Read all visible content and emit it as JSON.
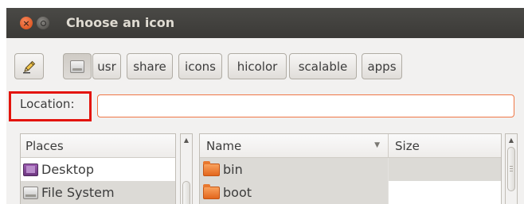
{
  "window": {
    "title": "Choose an icon",
    "close_glyph": "×"
  },
  "toolbar": {
    "edit_icon": "pencil-icon",
    "drive_icon": "harddisk-icon",
    "path_buttons": [
      "usr",
      "share",
      "icons",
      "hicolor",
      "scalable",
      "apps"
    ]
  },
  "location": {
    "label": "Location:",
    "value": "",
    "placeholder": ""
  },
  "places": {
    "header": "Places",
    "items": [
      {
        "label": "Desktop",
        "icon": "desktop-icon",
        "selected": false
      },
      {
        "label": "File System",
        "icon": "filesystem-icon",
        "selected": true
      }
    ]
  },
  "files": {
    "columns": [
      "Name",
      "Size"
    ],
    "sort_indicator": "▼",
    "rows": [
      {
        "name": "bin",
        "size": "",
        "icon": "folder-icon"
      },
      {
        "name": "boot",
        "size": "",
        "icon": "folder-icon"
      }
    ]
  },
  "colors": {
    "titlebar": "#3c3b37",
    "focus_border": "#f07746",
    "annotation_box": "#e3140c",
    "folder": "#e8782f"
  }
}
